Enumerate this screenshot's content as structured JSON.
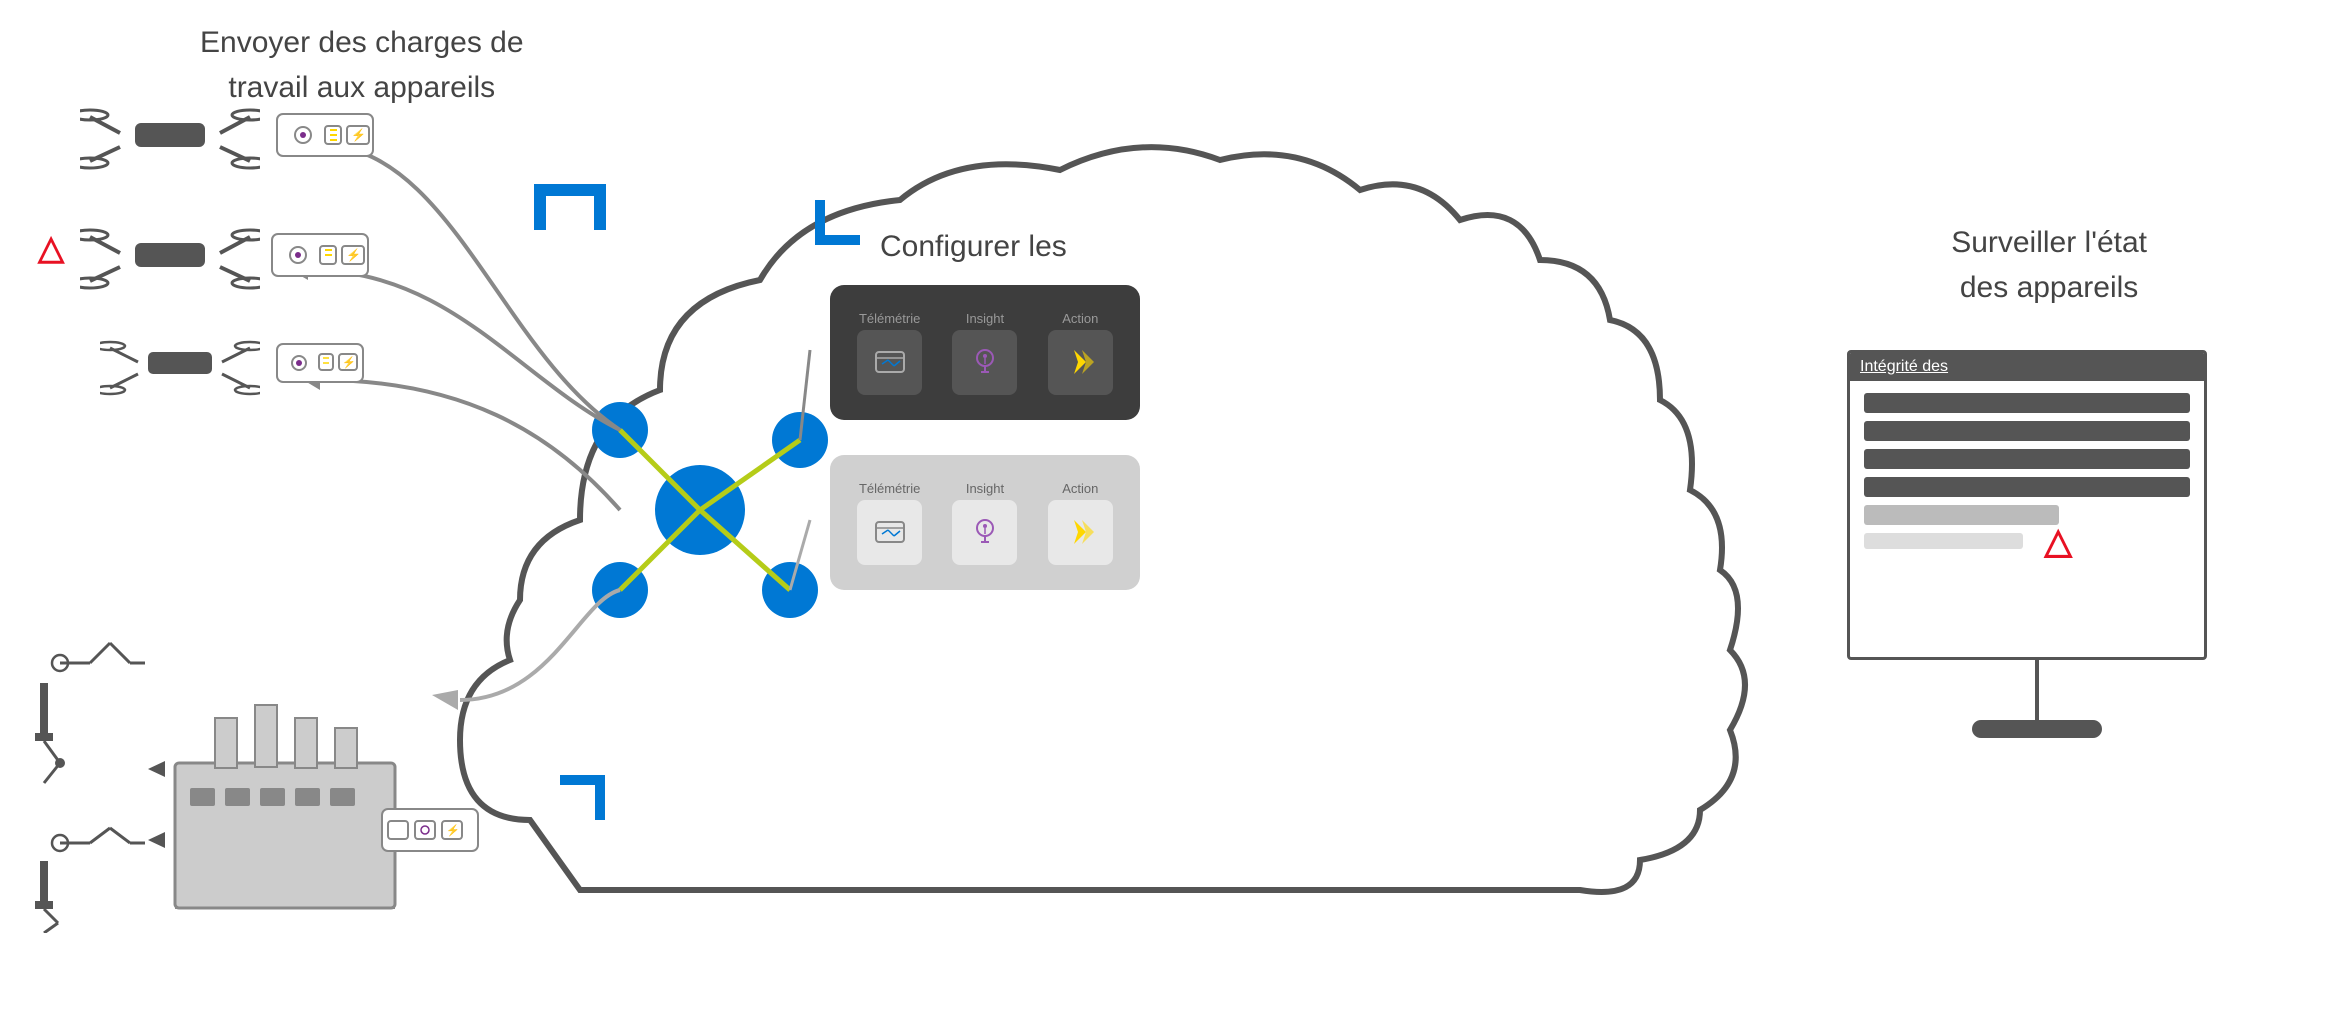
{
  "labels": {
    "top_title": "Envoyer des charges de",
    "top_title_2": "travail aux appareils",
    "right_title": "Surveiller l'état",
    "right_title_2": "des appareils",
    "configure_title": "Configurer les",
    "monitor_header": "Intégrité des"
  },
  "module_dark": {
    "telemetry_label": "Télémétrie",
    "insight_label": "Insight",
    "action_label": "Action"
  },
  "module_light": {
    "telemetry_label": "Télémétrie",
    "insight_label": "Insight",
    "action_label": "Action"
  },
  "colors": {
    "accent_blue": "#0078d4",
    "accent_green": "#b5cc18",
    "dark_bg": "#3a3a3a",
    "light_bg": "#d0d0d0",
    "cloud_border": "#555555",
    "warning_red": "#e81123",
    "insight_purple": "#6b2d8b",
    "action_yellow": "#ffd700"
  },
  "monitor_bars": [
    {
      "width": "85%",
      "color": "#555"
    },
    {
      "width": "85%",
      "color": "#555"
    },
    {
      "width": "85%",
      "color": "#555"
    },
    {
      "width": "85%",
      "color": "#555"
    },
    {
      "width": "55%",
      "color": "#aaa"
    },
    {
      "width": "45%",
      "color": "#ddd"
    }
  ]
}
